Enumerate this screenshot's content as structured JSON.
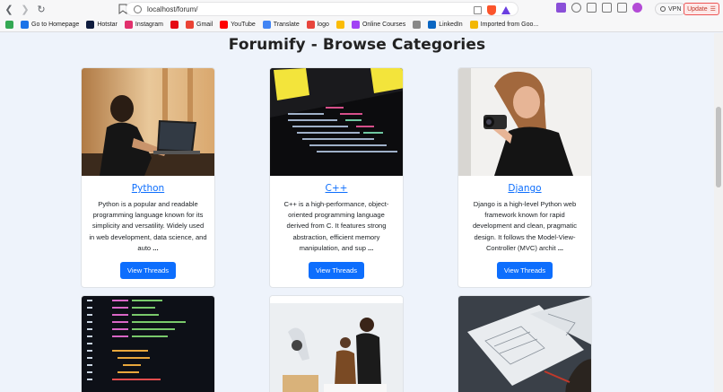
{
  "browser": {
    "url": "localhost/forum/",
    "vpn_label": "VPN",
    "update_label": "Update",
    "bookmarks": [
      {
        "label": "",
        "icon": "google-drive-icon",
        "color": "#34a853"
      },
      {
        "label": "Go to Homepage",
        "icon": "homepage-icon",
        "color": "#1a73e8"
      },
      {
        "label": "Hotstar",
        "icon": "hotstar-icon",
        "color": "#0f1c3f"
      },
      {
        "label": "Instagram",
        "icon": "instagram-icon",
        "color": "#e1306c"
      },
      {
        "label": "",
        "icon": "netflix-icon",
        "color": "#e50914"
      },
      {
        "label": "Gmail",
        "icon": "gmail-icon",
        "color": "#ea4335"
      },
      {
        "label": "YouTube",
        "icon": "youtube-icon",
        "color": "#ff0000"
      },
      {
        "label": "Translate",
        "icon": "translate-icon",
        "color": "#4285f4"
      },
      {
        "label": "logo",
        "icon": "logo-icon",
        "color": "#e8453c"
      },
      {
        "label": "",
        "icon": "drive-icon",
        "color": "#fbbc04"
      },
      {
        "label": "Online Courses",
        "icon": "courses-icon",
        "color": "#a142f4"
      },
      {
        "label": "",
        "icon": "bookmark-icon",
        "color": "#888888"
      },
      {
        "label": "LinkedIn",
        "icon": "linkedin-icon",
        "color": "#0a66c2"
      },
      {
        "label": "Imported from Goo...",
        "icon": "folder-icon",
        "color": "#f2b705"
      }
    ]
  },
  "page": {
    "title": "Forumify - Browse Categories",
    "cards": [
      {
        "title": "Python",
        "description": "Python is a popular and readable programming language known for its simplicity and versatility. Widely used in web development, data science, and auto",
        "ellipsis": "...",
        "button": "View Threads"
      },
      {
        "title": "C++",
        "description": "C++ is a high-performance, object-oriented programming language derived from C. It features strong abstraction, efficient memory manipulation, and sup",
        "ellipsis": "...",
        "button": "View Threads"
      },
      {
        "title": "Django",
        "description": "Django is a high-level Python web framework known for rapid development and clean, pragmatic design. It follows the Model-View-Controller (MVC) archit",
        "ellipsis": "...",
        "button": "View Threads"
      },
      {
        "title": "",
        "description": "",
        "ellipsis": "",
        "button": ""
      },
      {
        "title": "",
        "description": "",
        "ellipsis": "",
        "button": ""
      },
      {
        "title": "",
        "description": "",
        "ellipsis": "",
        "button": ""
      }
    ]
  },
  "colors": {
    "accent": "#0d6efd",
    "page_bg": "#eef3fb"
  }
}
